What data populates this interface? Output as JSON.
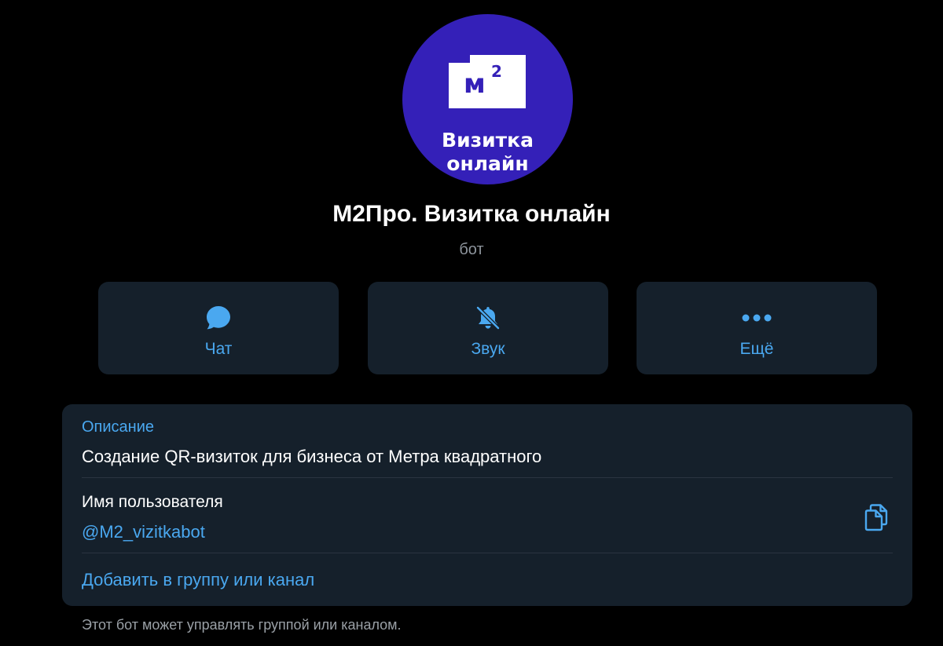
{
  "profile": {
    "avatar_square_text": "м",
    "avatar_superscript": "2",
    "avatar_line1": "Визитка",
    "avatar_line2": "онлайн",
    "name": "M2Про. Визитка онлайн",
    "type": "бот"
  },
  "actions": {
    "chat": {
      "label": "Чат",
      "icon": "chat-bubble-icon"
    },
    "sound": {
      "label": "Звук",
      "icon": "bell-muted-icon"
    },
    "more": {
      "label": "Ещё",
      "icon": "more-dots-icon"
    }
  },
  "info": {
    "description_label": "Описание",
    "description_text": "Создание QR-визиток для бизнеса от Метра квадратного",
    "username_label": "Имя пользователя",
    "username_value": "@M2_vizitkabot",
    "copy_icon": "copy-icon",
    "add_link": "Добавить в группу или канал"
  },
  "footnote": "Этот бот может управлять группой или каналом.",
  "colors": {
    "background": "#000000",
    "card": "#15202b",
    "accent": "#4aa8f0",
    "avatar_bg": "#3420b8",
    "secondary_text": "#8d949c"
  }
}
